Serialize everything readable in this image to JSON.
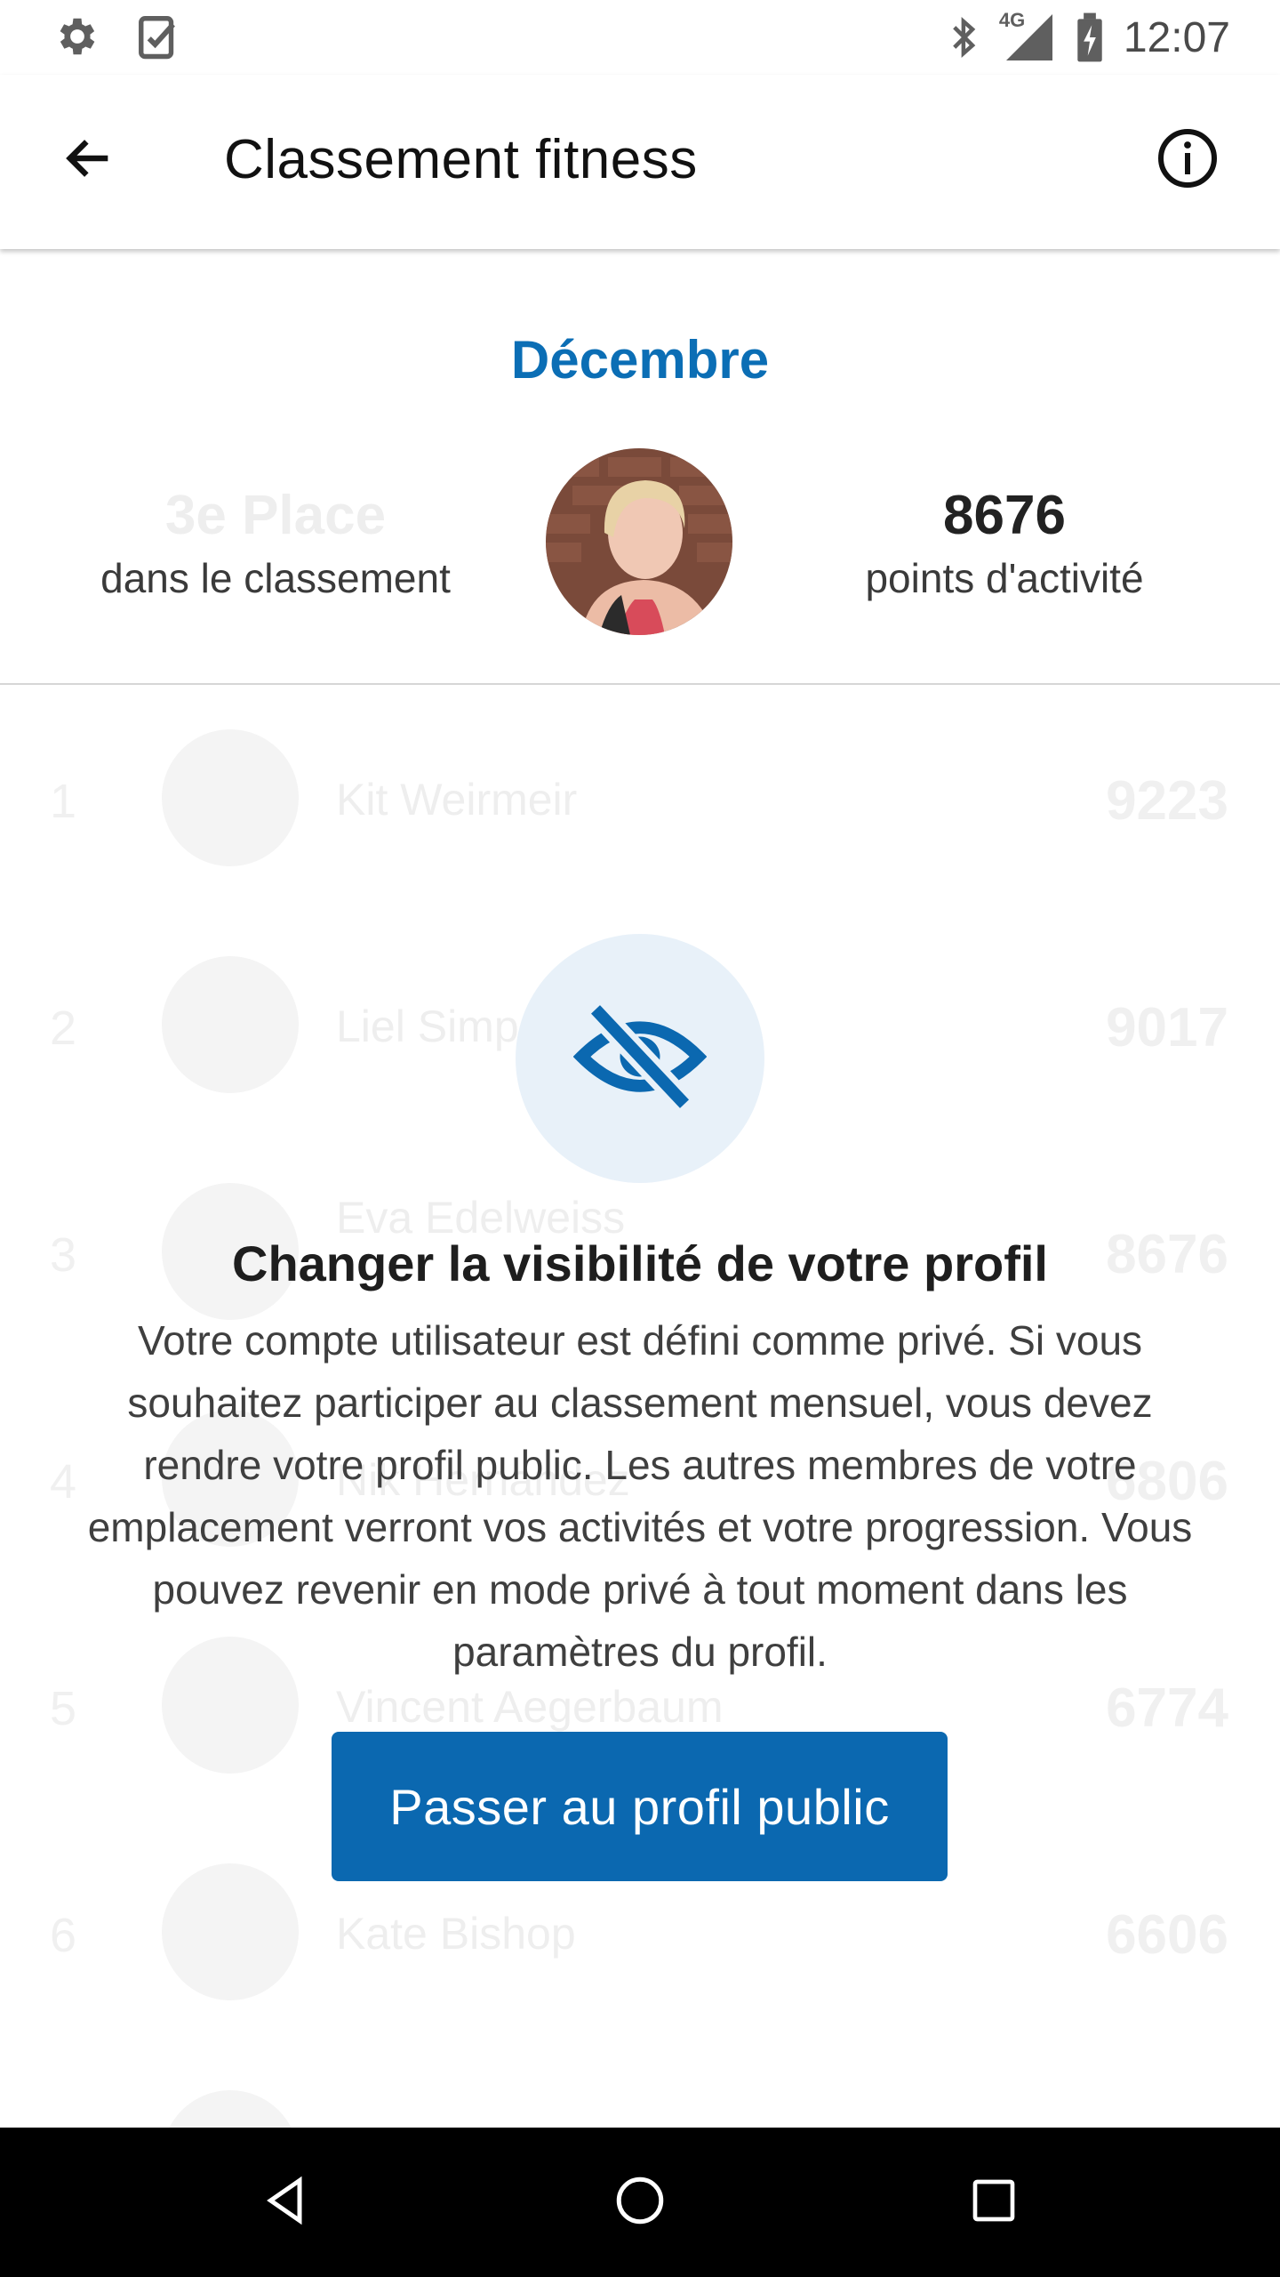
{
  "status_bar": {
    "time": "12:07",
    "network": "4G",
    "icons": [
      "settings-icon",
      "task-check-icon",
      "bluetooth-icon",
      "signal-icon",
      "battery-charging-icon"
    ]
  },
  "app_bar": {
    "title": "Classement fitness",
    "back_icon": "arrow-back-icon",
    "info_icon": "info-icon"
  },
  "summary": {
    "month": "Décembre",
    "rank_value": "3e Place",
    "rank_label": "dans le classement",
    "points_value": "8676",
    "points_label": "points d'activité"
  },
  "leaderboard": [
    {
      "rank": "1",
      "name": "Kit Weirmeir",
      "points": "9223"
    },
    {
      "rank": "2",
      "name": "Liel Simp",
      "points": "9017"
    },
    {
      "rank": "3",
      "name": "Eva Edelweiss",
      "points": "8676"
    },
    {
      "rank": "4",
      "name": "Nik Hernandez",
      "points": "6806"
    },
    {
      "rank": "5",
      "name": "Vincent Aegerbaum",
      "points": "6774"
    },
    {
      "rank": "6",
      "name": "Kate Bishop",
      "points": "6606"
    }
  ],
  "overlay": {
    "icon": "eye-off-icon",
    "title": "Changer la visibilité de votre profil",
    "text": "Votre compte utilisateur est défini comme privé. Si vous souhaitez participer au classement mensuel, vous devez rendre votre profil public. Les autres membres de votre emplacement verront vos activités et votre progression. Vous pouvez revenir en mode privé à tout moment dans les paramètres du profil.",
    "button_label": "Passer au profil public"
  },
  "colors": {
    "accent": "#0b68b0",
    "month": "#0b6eb5",
    "icon_circle": "#e8f1f9"
  }
}
